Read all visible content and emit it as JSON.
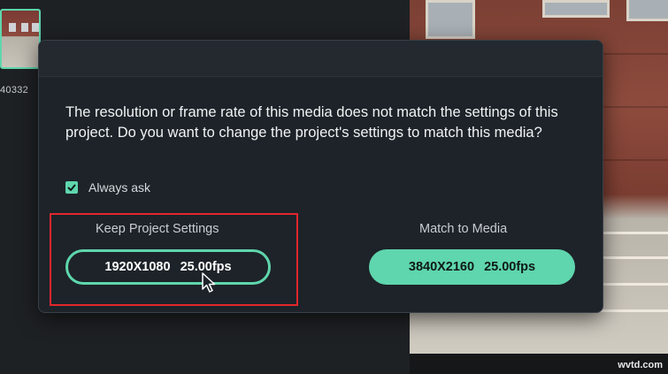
{
  "background": {
    "media_id": "40332"
  },
  "dialog": {
    "message": "The resolution or frame rate of this media does not match the settings of this project. Do you want to change the project's settings to match this media?",
    "always_ask": {
      "label": "Always ask",
      "checked": true
    },
    "keep_option": {
      "title": "Keep Project Settings",
      "resolution": "1920X1080",
      "fps": "25.00fps"
    },
    "match_option": {
      "title": "Match to Media",
      "resolution": "3840X2160",
      "fps": "25.00fps"
    }
  },
  "colors": {
    "accent": "#5fd6ad",
    "dialog_bg": "#1d2329",
    "highlight": "#e2262d"
  },
  "watermark": "wvtd.com",
  "icons": {
    "checkbox": "check-icon",
    "cursor": "mouse-pointer-icon"
  }
}
